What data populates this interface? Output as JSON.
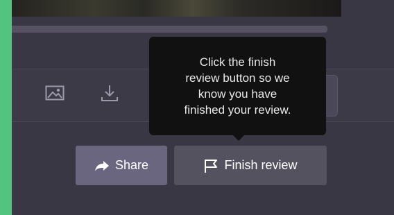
{
  "tooltip": {
    "text": "Click the finish\nreview button so we\nknow you have\nfinished your review."
  },
  "actions": {
    "share_label": "Share",
    "finish_review_label": "Finish review"
  },
  "toolbar": {
    "icons": [
      "image-icon",
      "download-icon"
    ]
  },
  "colors": {
    "panel": "#3a3744",
    "accent_green": "#52c47f",
    "tooltip_bg": "#111112",
    "share_button": "#6b6680",
    "finish_button": "#55525f"
  }
}
